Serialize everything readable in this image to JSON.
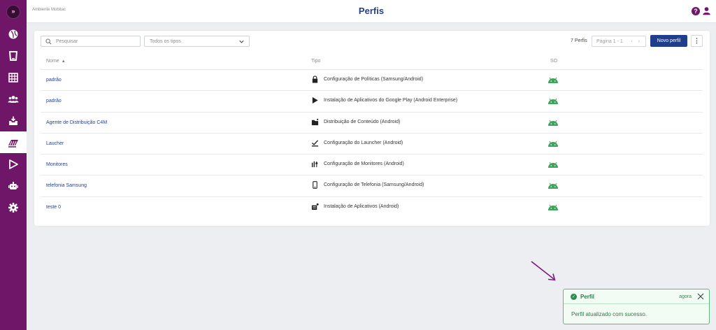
{
  "app": {
    "environment_label": "Ambiente Mobitac",
    "page_title": "Perfis",
    "logo_glyph": "»",
    "accent_color": "#6f1668",
    "brand_blue": "#243f91"
  },
  "sidebar": {
    "items": [
      {
        "icon": "sports-ball-icon"
      },
      {
        "icon": "devices-icon"
      },
      {
        "icon": "calendar-grid-icon"
      },
      {
        "icon": "users-group-icon"
      },
      {
        "icon": "inbox-download-icon"
      },
      {
        "icon": "profiles-stack-icon",
        "active": true
      },
      {
        "icon": "play-store-icon"
      },
      {
        "icon": "android-robot-icon"
      },
      {
        "icon": "settings-gear-icon"
      }
    ]
  },
  "header": {
    "help_glyph": "?",
    "user_icon": "user-icon"
  },
  "toolbar": {
    "search_placeholder": "Pesquisar",
    "type_filter_value": "Todos os tipos",
    "count_label": "7 Perfis",
    "pager_label": "Página 1 - 1",
    "pager_arrows": "‹ ›",
    "new_button_label": "Novo perfil",
    "more_glyph": "⋮"
  },
  "table": {
    "columns": {
      "name": "Nome",
      "name_sort": "▲",
      "type": "Tipo",
      "os": "SO"
    },
    "rows": [
      {
        "name": "padrão",
        "type": "Configuração de Políticas (Samsung/Android)",
        "type_icon": "lock-icon",
        "os_icon": "android-icon"
      },
      {
        "name": "padrão",
        "type": "Instalação de Aplicativos do Google Play (Android Enterprise)",
        "type_icon": "play-icon",
        "os_icon": "android-icon"
      },
      {
        "name": "Agente de Distribuição C4M",
        "type": "Distribuição de Conteúdo (Android)",
        "type_icon": "folder-icon",
        "os_icon": "android-icon"
      },
      {
        "name": "Laucher",
        "type": "Configuração do Launcher (Android)",
        "type_icon": "launcher-check-icon",
        "os_icon": "android-icon"
      },
      {
        "name": "Monitores",
        "type": "Configuração de Monitores (Android)",
        "type_icon": "monitor-bars-icon",
        "os_icon": "android-icon"
      },
      {
        "name": "telefonia Samsung",
        "type": "Configuração de Telefonia (Samsung/Android)",
        "type_icon": "phone-icon",
        "os_icon": "android-icon"
      },
      {
        "name": "teste 0",
        "type": "Instalação de Aplicativos (Android)",
        "type_icon": "app-install-icon",
        "os_icon": "android-icon"
      }
    ]
  },
  "toast": {
    "title": "Perfil",
    "time": "agora",
    "message": "Perfil atualizado com sucesso.",
    "check_glyph": "✓",
    "success_color": "#2f8a4e"
  }
}
